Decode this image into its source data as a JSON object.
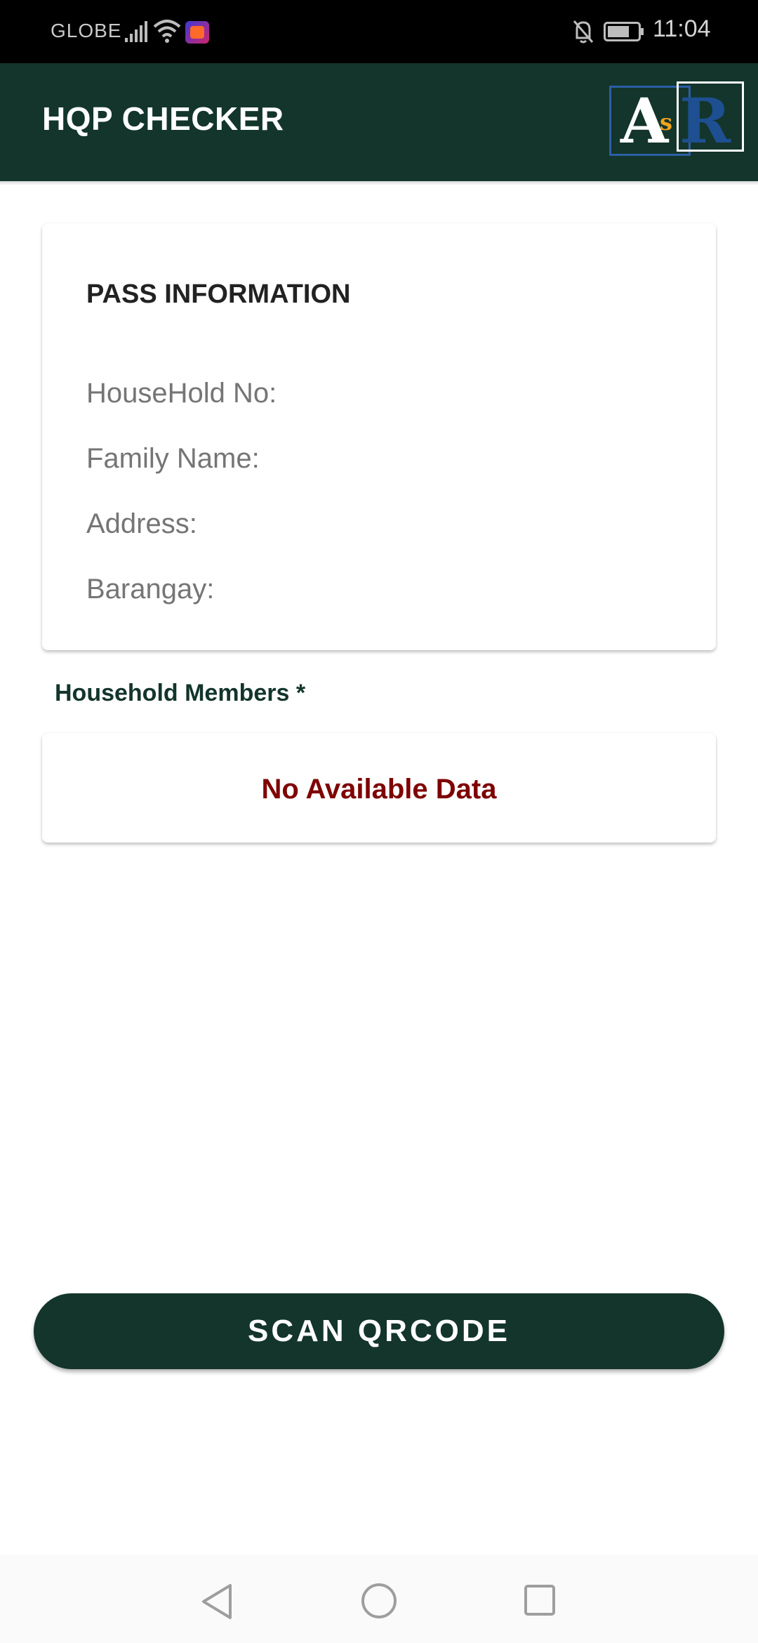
{
  "status_bar": {
    "carrier": "GLOBE",
    "time": "11:04",
    "icons": [
      "signal-icon",
      "wifi-icon",
      "app-badge-icon",
      "mute-icon",
      "battery-icon"
    ]
  },
  "app_bar": {
    "title": "HQP CHECKER",
    "logo_text": "AsR",
    "background_color": "#13352b"
  },
  "pass_card": {
    "heading": "PASS INFORMATION",
    "fields": {
      "household_no": "HouseHold No:",
      "family_name": "Family Name:",
      "address": "Address:",
      "barangay": "Barangay:"
    }
  },
  "members": {
    "label": "Household Members *",
    "empty_text": "No Available Data",
    "empty_color": "#7f0000"
  },
  "scan_button": {
    "label": "SCAN QRCODE"
  },
  "nav_bar": {
    "icons": [
      "back-icon",
      "home-icon",
      "recents-icon"
    ]
  }
}
